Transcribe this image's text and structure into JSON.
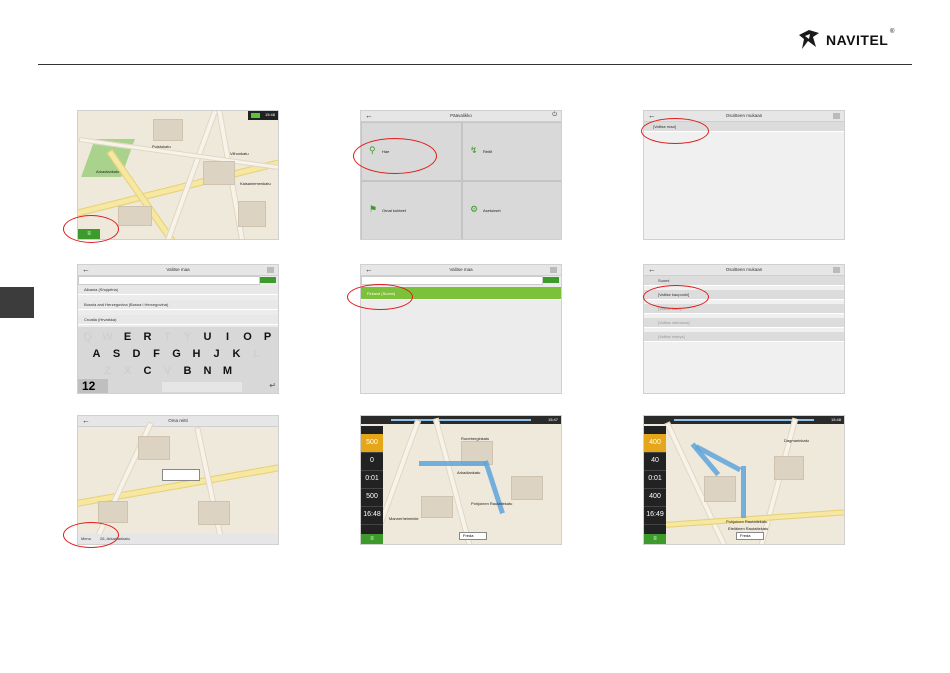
{
  "brand": {
    "name": "NAVITEL"
  },
  "shots": {
    "s1": {
      "time": "15:48",
      "labels": [
        "Arkadiankatu",
        "Puistokatu",
        "Vilhonkatu",
        "Kaisaniemenkatu"
      ]
    },
    "s2": {
      "title": "Päävalikko",
      "tiles": [
        "Hae",
        "Reitit",
        "Omat kohteet",
        "Asetukset"
      ]
    },
    "s3": {
      "title": "Osoitteen mukaan",
      "rows": [
        "[Valitse maa]"
      ]
    },
    "s4": {
      "title": "Valitse maa",
      "rows": [
        "Albania (Shqipëria)",
        "Bosnia and Herzegovina (Bosna i Hercegovina)",
        "Croatia (Hrvatska)"
      ],
      "keys1": [
        "Q",
        "W",
        "E",
        "R",
        "T",
        "Y",
        "U",
        "I",
        "O",
        "P"
      ],
      "keys2": [
        "A",
        "S",
        "D",
        "F",
        "G",
        "H",
        "J",
        "K",
        "L"
      ],
      "keys3": [
        "Z",
        "X",
        "C",
        "V",
        "B",
        "N",
        "M"
      ],
      "num": "12"
    },
    "s5": {
      "title": "Valitse maa",
      "rows": [
        "Finland (Suomi)"
      ]
    },
    "s6": {
      "title": "Osoitteen mukaan",
      "rows": [
        "Suomi",
        "[Valitse kaupunki]",
        "[Valitse katu]",
        "[Valitse rakennus]",
        "[Valitse risteys]"
      ]
    },
    "s7": {
      "title": "Oma reitti",
      "footer": "26, Arkadiankatu",
      "menu": "Menu"
    },
    "s8": {
      "time": "15:47",
      "cells": [
        "500",
        "0",
        "0:01",
        "500",
        "16:48"
      ],
      "labels": [
        "Arkadiankatu",
        "Runeberginkatu",
        "Pohjoinen Rautatiekatu",
        "Mannerheimintie",
        "Freda"
      ]
    },
    "s9": {
      "time": "15:48",
      "cells": [
        "400",
        "40",
        "0:01",
        "400",
        "16:49"
      ],
      "labels": [
        "Pohjoinen Rautatiekatu",
        "Eteläinen Rautatiekatu",
        "Dagmarinkatu",
        "Freda"
      ]
    }
  }
}
